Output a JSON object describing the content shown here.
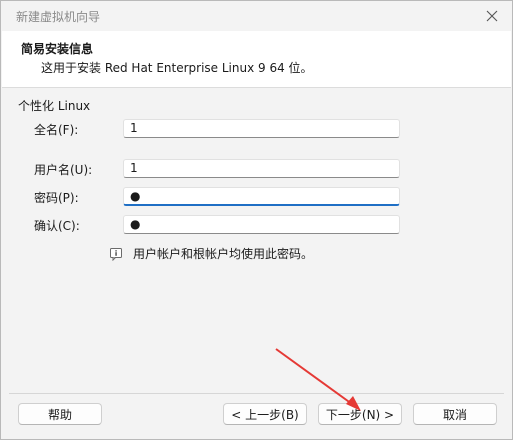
{
  "window": {
    "title": "新建虚拟机向导"
  },
  "header": {
    "title": "简易安装信息",
    "subtitle": "这用于安装 Red Hat Enterprise Linux 9 64 位。"
  },
  "section": {
    "label": "个性化 Linux"
  },
  "fields": {
    "fullname": {
      "label": "全名(F):",
      "value": "1"
    },
    "username": {
      "label": "用户名(U):",
      "value": "1"
    },
    "password": {
      "label": "密码(P):",
      "value": "●"
    },
    "confirm": {
      "label": "确认(C):",
      "value": "●"
    }
  },
  "info": {
    "text": "用户帐户和根帐户均使用此密码。",
    "icon": "info-icon"
  },
  "buttons": {
    "help": "帮助",
    "back": "< 上一步(B)",
    "next": "下一步(N) >",
    "cancel": "取消"
  },
  "colors": {
    "focus_accent": "#1f6fc5",
    "annotation_arrow": "#e53935"
  }
}
